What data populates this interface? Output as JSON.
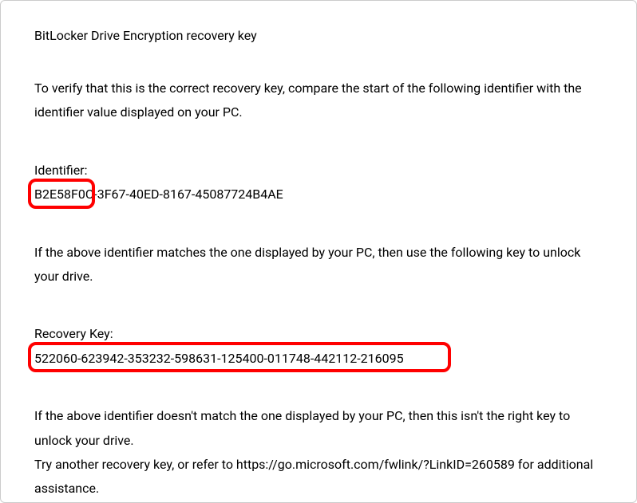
{
  "title": "BitLocker Drive Encryption recovery key",
  "intro": "To verify that this is the correct recovery key, compare the start of the following identifier with the identifier value displayed on your PC.",
  "identifier": {
    "label": "Identifier:",
    "value": "B2E58F0C-3F67-40ED-8167-45087724B4AE"
  },
  "match_instruction": "If the above identifier matches the one displayed by your PC, then use the following key to unlock your drive.",
  "recovery_key": {
    "label": "Recovery Key:",
    "value": "522060-623942-353232-598631-125400-011748-442112-216095"
  },
  "no_match_line1": "If the above identifier doesn't match the one displayed by your PC, then this isn't the right key to unlock your drive.",
  "no_match_line2": "Try another recovery key, or refer to https://go.microsoft.com/fwlink/?LinkID=260589 for additional assistance."
}
